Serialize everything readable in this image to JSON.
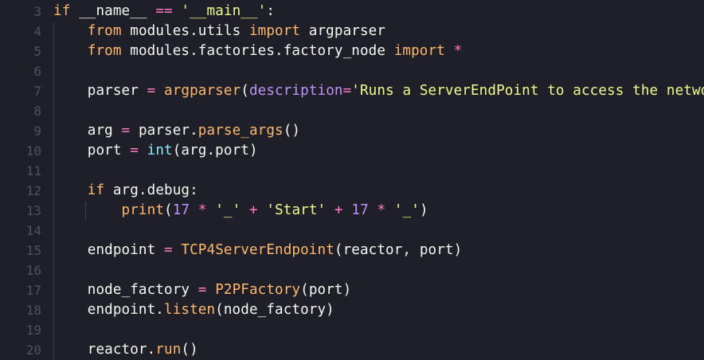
{
  "editor": {
    "lines": [
      {
        "number": "3",
        "tokens": [
          {
            "t": "if",
            "c": "kw"
          },
          {
            "t": " __name__ ",
            "c": ""
          },
          {
            "t": "==",
            "c": "op"
          },
          {
            "t": " ",
            "c": ""
          },
          {
            "t": "'__main__'",
            "c": "str"
          },
          {
            "t": ":",
            "c": ""
          }
        ]
      },
      {
        "number": "4",
        "tokens": [
          {
            "t": "    ",
            "c": ""
          },
          {
            "t": "from",
            "c": "kw"
          },
          {
            "t": " modules.utils ",
            "c": ""
          },
          {
            "t": "import",
            "c": "kw"
          },
          {
            "t": " argparser",
            "c": ""
          }
        ]
      },
      {
        "number": "5",
        "tokens": [
          {
            "t": "    ",
            "c": ""
          },
          {
            "t": "from",
            "c": "kw"
          },
          {
            "t": " modules.factories.factory_node ",
            "c": ""
          },
          {
            "t": "import",
            "c": "kw"
          },
          {
            "t": " ",
            "c": ""
          },
          {
            "t": "*",
            "c": "op"
          }
        ]
      },
      {
        "number": "6",
        "tokens": []
      },
      {
        "number": "7",
        "tokens": [
          {
            "t": "    parser ",
            "c": ""
          },
          {
            "t": "=",
            "c": "op"
          },
          {
            "t": " ",
            "c": ""
          },
          {
            "t": "argparser",
            "c": "fn"
          },
          {
            "t": "(",
            "c": ""
          },
          {
            "t": "description",
            "c": "param"
          },
          {
            "t": "=",
            "c": "op"
          },
          {
            "t": "'Runs a ServerEndPoint to access the network'",
            "c": "str"
          },
          {
            "t": ")",
            "c": ""
          }
        ]
      },
      {
        "number": "8",
        "tokens": []
      },
      {
        "number": "9",
        "tokens": [
          {
            "t": "    arg ",
            "c": ""
          },
          {
            "t": "=",
            "c": "op"
          },
          {
            "t": " parser.",
            "c": ""
          },
          {
            "t": "parse_args",
            "c": "fn"
          },
          {
            "t": "()",
            "c": ""
          }
        ]
      },
      {
        "number": "10",
        "tokens": [
          {
            "t": "    port ",
            "c": ""
          },
          {
            "t": "=",
            "c": "op"
          },
          {
            "t": " ",
            "c": ""
          },
          {
            "t": "int",
            "c": "builtin"
          },
          {
            "t": "(arg.port)",
            "c": ""
          }
        ]
      },
      {
        "number": "11",
        "tokens": []
      },
      {
        "number": "12",
        "tokens": [
          {
            "t": "    ",
            "c": ""
          },
          {
            "t": "if",
            "c": "kw"
          },
          {
            "t": " arg.debug:",
            "c": ""
          }
        ]
      },
      {
        "number": "13",
        "tokens": [
          {
            "t": "        ",
            "c": ""
          },
          {
            "t": "print",
            "c": "fn"
          },
          {
            "t": "(",
            "c": ""
          },
          {
            "t": "17",
            "c": "num"
          },
          {
            "t": " ",
            "c": ""
          },
          {
            "t": "*",
            "c": "op"
          },
          {
            "t": " ",
            "c": ""
          },
          {
            "t": "'_'",
            "c": "str"
          },
          {
            "t": " ",
            "c": ""
          },
          {
            "t": "+",
            "c": "op"
          },
          {
            "t": " ",
            "c": ""
          },
          {
            "t": "'Start'",
            "c": "str"
          },
          {
            "t": " ",
            "c": ""
          },
          {
            "t": "+",
            "c": "op"
          },
          {
            "t": " ",
            "c": ""
          },
          {
            "t": "17",
            "c": "num"
          },
          {
            "t": " ",
            "c": ""
          },
          {
            "t": "*",
            "c": "op"
          },
          {
            "t": " ",
            "c": ""
          },
          {
            "t": "'_'",
            "c": "str"
          },
          {
            "t": ")",
            "c": ""
          }
        ]
      },
      {
        "number": "14",
        "tokens": []
      },
      {
        "number": "15",
        "tokens": [
          {
            "t": "    endpoint ",
            "c": ""
          },
          {
            "t": "=",
            "c": "op"
          },
          {
            "t": " ",
            "c": ""
          },
          {
            "t": "TCP4ServerEndpoint",
            "c": "fn"
          },
          {
            "t": "(reactor, port)",
            "c": ""
          }
        ]
      },
      {
        "number": "16",
        "tokens": []
      },
      {
        "number": "17",
        "tokens": [
          {
            "t": "    node_factory ",
            "c": ""
          },
          {
            "t": "=",
            "c": "op"
          },
          {
            "t": " ",
            "c": ""
          },
          {
            "t": "P2PFactory",
            "c": "fn"
          },
          {
            "t": "(port)",
            "c": ""
          }
        ]
      },
      {
        "number": "18",
        "tokens": [
          {
            "t": "    endpoint.",
            "c": ""
          },
          {
            "t": "listen",
            "c": "fn"
          },
          {
            "t": "(node_factory)",
            "c": ""
          }
        ]
      },
      {
        "number": "19",
        "tokens": []
      },
      {
        "number": "20",
        "tokens": [
          {
            "t": "    reactor.",
            "c": ""
          },
          {
            "t": "run",
            "c": "fn"
          },
          {
            "t": "()",
            "c": ""
          }
        ]
      }
    ]
  }
}
